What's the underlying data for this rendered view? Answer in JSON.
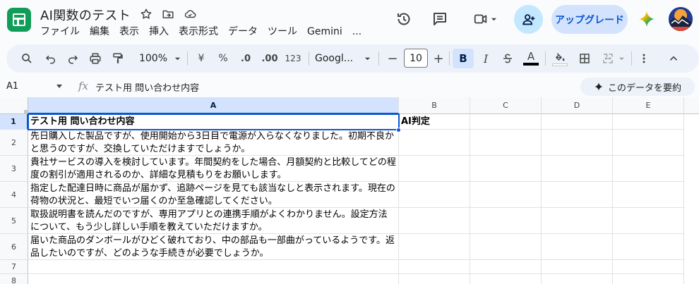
{
  "app": {
    "doc_title": "AI関数のテスト",
    "menu": [
      "ファイル",
      "編集",
      "表示",
      "挿入",
      "表示形式",
      "データ",
      "ツール",
      "Gemini",
      "..."
    ],
    "upgrade_label": "アップグレード",
    "colors": {
      "accent": "#0b57d0",
      "app_green": "#0f9d58",
      "upgrade_bg": "#d3e3fd",
      "share_bg": "#c2e7ff"
    }
  },
  "toolbar": {
    "zoom": "100%",
    "currency": "¥",
    "percent": "%",
    "decrease_decimal": ".0",
    "increase_decimal": ".00",
    "format_123": "123",
    "font_name": "Googl...",
    "font_size": "10",
    "bold": "B",
    "italic": "I",
    "text_color": "A"
  },
  "formula_bar": {
    "name_box": "A1",
    "fx": "fx",
    "formula": "テスト用 問い合わせ内容",
    "summarize_label": "このデータを要約"
  },
  "grid": {
    "columns": [
      "A",
      "B",
      "C",
      "D",
      "E"
    ],
    "rows": [
      "1",
      "2",
      "3",
      "4",
      "5",
      "6",
      "7",
      "8"
    ],
    "cells": {
      "A1": "テスト用 問い合わせ内容",
      "B1": "AI判定",
      "A2": "先日購入した製品ですが、使用開始から3日目で電源が入らなくなりました。初期不良かと思うのですが、交換していただけますでしょうか。",
      "A3": "貴社サービスの導入を検討しています。年間契約をした場合、月額契約と比較してどの程度の割引が適用されるのか、詳細な見積もりをお願いします。",
      "A4": "指定した配達日時に商品が届かず、追跡ページを見ても該当なしと表示されます。現在の荷物の状況と、最短でいつ届くのか至急確認してください。",
      "A5": "取扱説明書を読んだのですが、専用アプリとの連携手順がよくわかりません。設定方法について、もう少し詳しい手順を教えていただけますか。",
      "A6": "届いた商品のダンボールがひどく破れており、中の部品も一部曲がっているようです。返品したいのですが、どのような手続きが必要でしょうか。"
    }
  }
}
